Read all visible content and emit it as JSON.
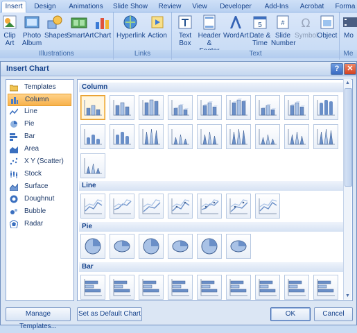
{
  "ribbon": {
    "tabs": [
      {
        "label": "Insert",
        "active": true
      },
      {
        "label": "Design"
      },
      {
        "label": "Animations"
      },
      {
        "label": "Slide Show"
      },
      {
        "label": "Review"
      },
      {
        "label": "View"
      },
      {
        "label": "Developer"
      },
      {
        "label": "Add-Ins"
      },
      {
        "label": "Acrobat"
      },
      {
        "label": "Forma"
      }
    ],
    "illustrations": {
      "label": "Illustrations",
      "clip_art": "Clip Art",
      "photo_album": "Photo Album",
      "shapes": "Shapes",
      "smartart": "SmartArt",
      "chart": "Chart"
    },
    "links": {
      "label": "Links",
      "hyperlink": "Hyperlink",
      "action": "Action"
    },
    "text": {
      "label": "Text",
      "text_box": "Text Box",
      "header_footer": "Header & Footer",
      "wordart": "WordArt",
      "date_time": "Date & Time",
      "slide_number": "Slide Number",
      "symbol": "Symbol",
      "object": "Object"
    },
    "media": {
      "label": "Me",
      "movie": "Mo"
    }
  },
  "dialog": {
    "title": "Insert Chart",
    "help_glyph": "?",
    "close_glyph": "✕",
    "categories": [
      {
        "label": "Templates",
        "icon": "folder-icon"
      },
      {
        "label": "Column",
        "icon": "column-chart-icon",
        "selected": true
      },
      {
        "label": "Line",
        "icon": "line-chart-icon"
      },
      {
        "label": "Pie",
        "icon": "pie-chart-icon"
      },
      {
        "label": "Bar",
        "icon": "bar-chart-icon"
      },
      {
        "label": "Area",
        "icon": "area-chart-icon"
      },
      {
        "label": "X Y (Scatter)",
        "icon": "scatter-chart-icon"
      },
      {
        "label": "Stock",
        "icon": "stock-chart-icon"
      },
      {
        "label": "Surface",
        "icon": "surface-chart-icon"
      },
      {
        "label": "Doughnut",
        "icon": "doughnut-chart-icon"
      },
      {
        "label": "Bubble",
        "icon": "bubble-chart-icon"
      },
      {
        "label": "Radar",
        "icon": "radar-chart-icon"
      }
    ],
    "sections": {
      "column": "Column",
      "line": "Line",
      "pie": "Pie",
      "bar": "Bar"
    },
    "buttons": {
      "manage_templates": "Manage Templates...",
      "set_default": "Set as Default Chart",
      "ok": "OK",
      "cancel": "Cancel"
    }
  }
}
